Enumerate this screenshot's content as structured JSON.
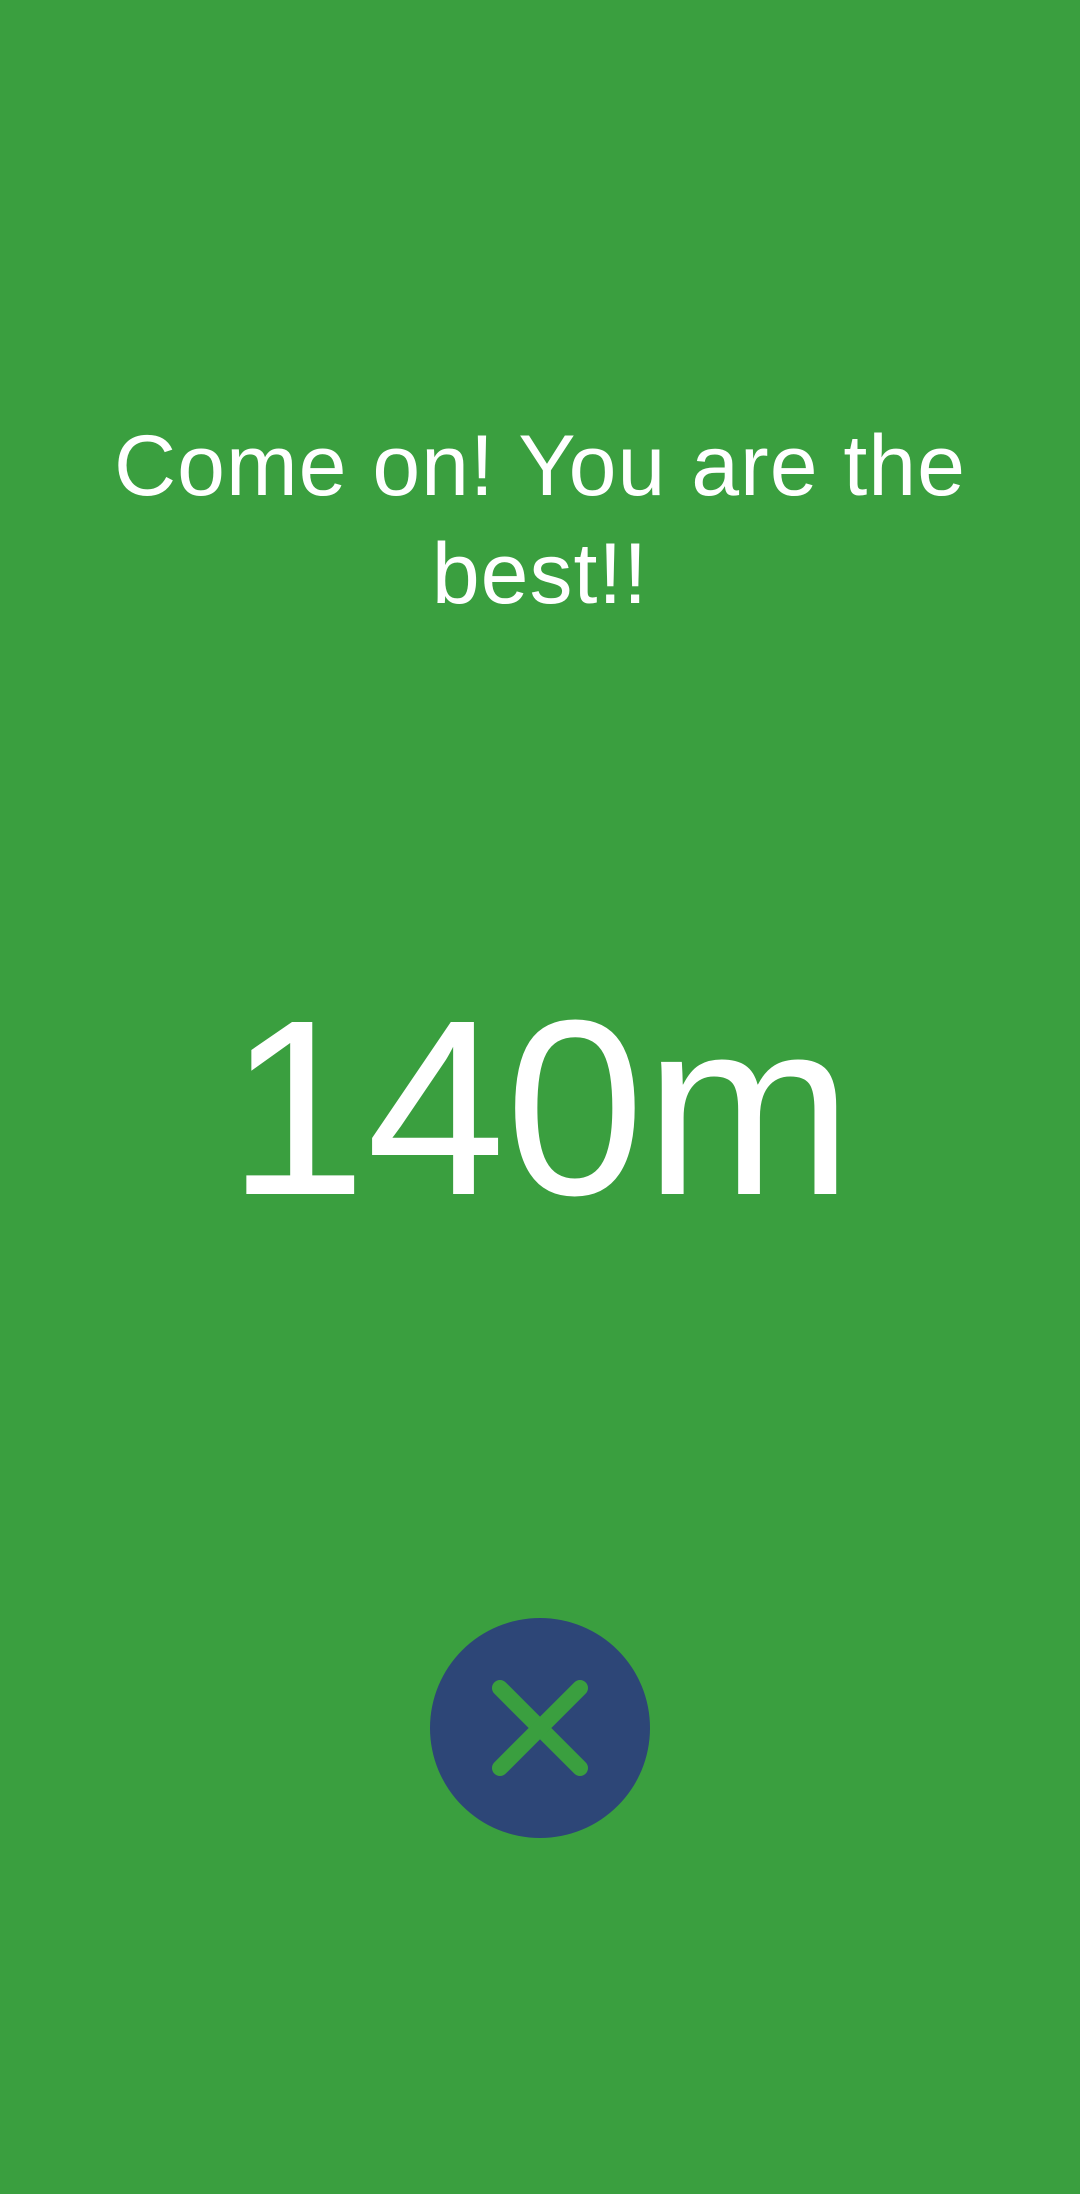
{
  "colors": {
    "background": "#3a9f3f",
    "text": "#ffffff",
    "close_button_bg": "#2d4677",
    "close_icon": "#3a9f3f"
  },
  "message": {
    "text": "Come on! You are the best!!"
  },
  "distance": {
    "text": "140m"
  },
  "close_button": {
    "icon": "close-icon"
  }
}
